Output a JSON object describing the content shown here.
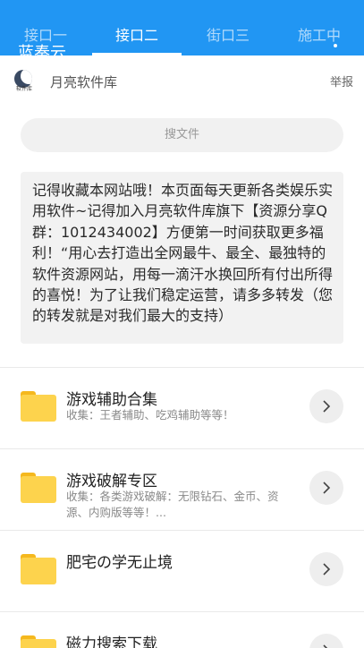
{
  "tabs": [
    {
      "label": "接口一"
    },
    {
      "label": "接口二"
    },
    {
      "label": "街口三"
    },
    {
      "label": "施工中"
    }
  ],
  "brand_title": "蓝奏云",
  "header": {
    "logo_text": "软件库",
    "site_name": "月亮软件库",
    "report_label": "举报"
  },
  "search": {
    "placeholder": "搜文件"
  },
  "notice": {
    "text": "记得收藏本网站哦！本页面每天更新各类娱乐实用软件~记得加入月亮软件库旗下【资源分享Q群：1012434002】方便第一时间获取更多福利！“用心去打造出全网最牛、最全、最独特的软件资源网站，用每一滴汗水换回所有付出所得的喜悦！为了让我们稳定运营，请多多转发（您的转发就是对我们最大的支持）"
  },
  "items": [
    {
      "title": "游戏辅助合集",
      "desc": "收集：王者辅助、吃鸡辅助等等！"
    },
    {
      "title": "游戏破解专区",
      "desc": "收集：各类游戏破解：无限钻石、金币、资源、内购版等等！..."
    },
    {
      "title": "肥宅の学无止境",
      "desc": ""
    },
    {
      "title": "磁力搜索下载",
      "desc": ""
    }
  ],
  "colors": {
    "accent": "#2196f3",
    "folder": "#fdd34d"
  }
}
